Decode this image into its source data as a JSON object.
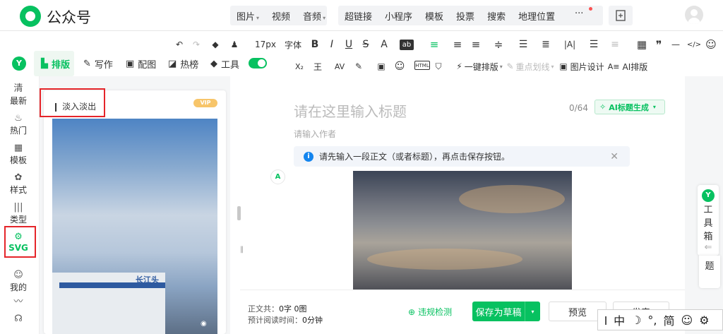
{
  "app": {
    "name": "公众号"
  },
  "topmenu": {
    "group1": [
      "图片",
      "视频",
      "音频"
    ],
    "group2": [
      "超链接",
      "小程序",
      "模板",
      "投票",
      "搜索",
      "地理位置"
    ],
    "more": "···"
  },
  "toolbar": {
    "row1": [
      "↶",
      "↷",
      "◆",
      "♟",
      "17px",
      "字体",
      "B",
      "I",
      "U",
      "S",
      "A",
      "ab",
      "≡",
      "≡",
      "≡",
      "≑",
      "☰",
      "≣",
      "|A|",
      "☰",
      "≡",
      "▦",
      "❞",
      "—",
      "</>",
      "☺"
    ],
    "font_size": "17px",
    "font_family": "字体",
    "row2": [
      "X₂",
      "王",
      "AV",
      "✎",
      "▣",
      "☺",
      "HTML",
      "⛉"
    ],
    "one_click": "一键排版",
    "highlight": "重点划线",
    "image_design": "图片设计",
    "ai_layout": "AI排版"
  },
  "panel": {
    "tabs": [
      "排版",
      "写作",
      "配图",
      "热榜",
      "工具"
    ],
    "active_tab": "排版",
    "card_title": "淡入淡出",
    "vip": "VIP",
    "sign_text": "长江头"
  },
  "leftnav": [
    {
      "icon": "清",
      "label": "最新"
    },
    {
      "icon": "♨",
      "label": "热门"
    },
    {
      "icon": "▦",
      "label": "模板"
    },
    {
      "icon": "✿",
      "label": "样式"
    },
    {
      "icon": "|||",
      "label": "类型"
    },
    {
      "icon": "⚙",
      "label": "SVG",
      "active": true
    },
    {
      "icon": "☺",
      "label": "我的"
    },
    {
      "icon": "〰",
      "label": ""
    },
    {
      "icon": "☊",
      "label": ""
    }
  ],
  "editor": {
    "title_placeholder": "请在这里输入标题",
    "title_count": "0/64",
    "ai_title_button": "AI标题生成",
    "author_placeholder": "请输入作者",
    "notice": "请先输入一段正文（或者标题），再点击保存按钮。"
  },
  "footer": {
    "word_count_label": "正文共：",
    "word_count_value": "0字 0图",
    "read_time_label": "预计阅读时间：",
    "read_time_value": "0分钟",
    "violation_check": "违规检测",
    "save_draft": "保存为草稿",
    "preview": "预览",
    "publish": "发表"
  },
  "right_tool": {
    "label_chars": [
      "工",
      "具",
      "箱"
    ],
    "arrow": "⇐",
    "partial": "题"
  },
  "ime": {
    "items": [
      "中",
      "☽",
      "°,",
      "简",
      "☺",
      "⚙"
    ]
  },
  "colors": {
    "accent": "#07c160",
    "alert": "#e5252a",
    "info": "#1485ee"
  }
}
